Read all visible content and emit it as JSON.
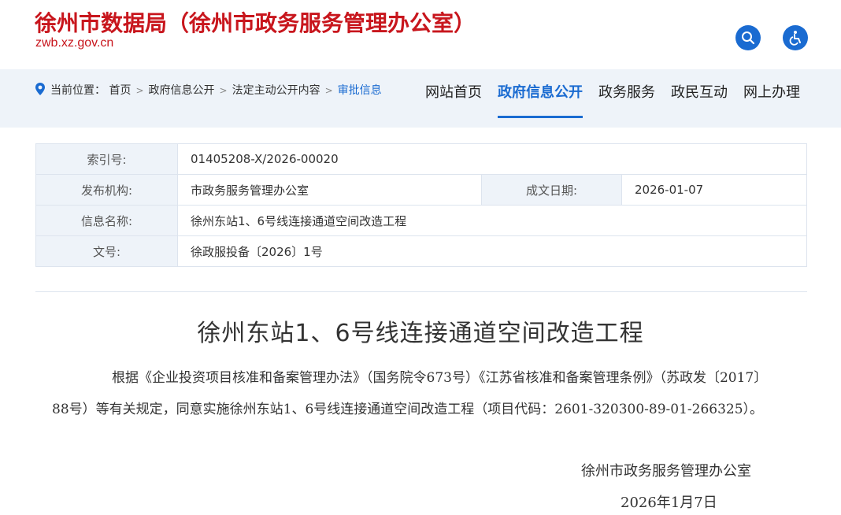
{
  "header": {
    "site_title": "徐州市数据局（徐州市政务服务管理办公室）",
    "site_domain": "zwb.xz.gov.cn",
    "search_icon": "search-icon",
    "accessibility_icon": "accessibility-icon"
  },
  "breadcrumb": {
    "prefix": "当前位置：",
    "items": [
      "首页",
      "政府信息公开",
      "法定主动公开内容",
      "审批信息"
    ]
  },
  "nav": {
    "items": [
      "网站首页",
      "政府信息公开",
      "政务服务",
      "政民互动",
      "网上办理"
    ],
    "active": "政府信息公开"
  },
  "meta": {
    "index_label": "索引号:",
    "index_value": "01405208-X/2026-00020",
    "publisher_label": "发布机构:",
    "publisher_value": "市政务服务管理办公室",
    "date_label": "成文日期:",
    "date_value": "2026-01-07",
    "name_label": "信息名称:",
    "name_value": "徐州东站1、6号线连接通道空间改造工程",
    "doc_label": "文号:",
    "doc_value": "徐政服投备〔2026〕1号"
  },
  "article": {
    "title": "徐州东站1、6号线连接通道空间改造工程",
    "body": "根据《企业投资项目核准和备案管理办法》（国务院令673号）《江苏省核准和备案管理条例》（苏政发〔2017〕88号）等有关规定，同意实施徐州东站1、6号线连接通道空间改造工程（项目代码：2601-320300-89-01-266325）。",
    "signature": "徐州市政务服务管理办公室",
    "date": "2026年1月7日"
  },
  "colors": {
    "brand_red": "#c8161d",
    "accent_blue": "#1a6bd1",
    "band_bg": "#eef3f9"
  }
}
